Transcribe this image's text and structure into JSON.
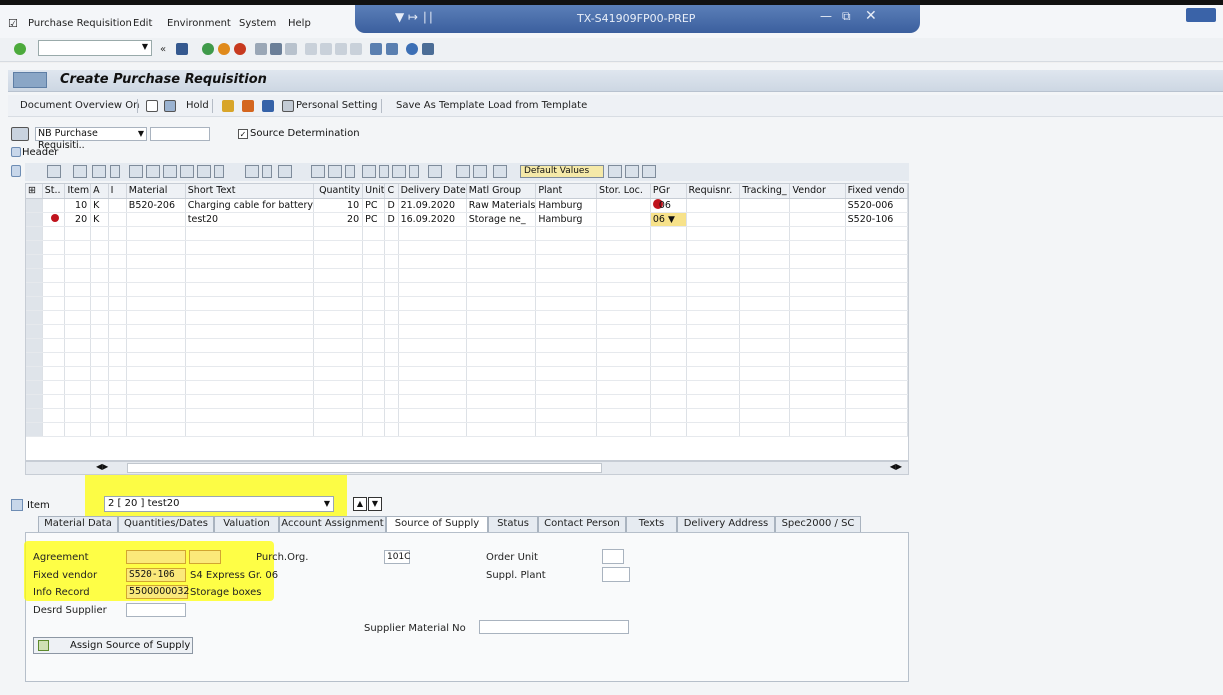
{
  "menu": {
    "items": [
      "Purchase Requisition",
      "Edit",
      "Environment",
      "System",
      "Help"
    ]
  },
  "window": {
    "title": "TX-S41909FP00-PREP"
  },
  "page": {
    "title": "Create Purchase Requisition"
  },
  "app_toolbar": {
    "document_overview": "Document Overview On",
    "hold": "Hold",
    "personal_setting": "Personal Setting",
    "save_as_template": "Save As Template",
    "load_from_template": "Load from Template"
  },
  "doc_type": {
    "value": "NB Purchase Requisiti..",
    "source_determination": "Source Determination",
    "source_determination_checked": true
  },
  "header": {
    "label": "Header"
  },
  "grid_toolbar": {
    "default_values": "Default Values"
  },
  "grid": {
    "columns": [
      "St..",
      "Item",
      "A",
      "I",
      "Material",
      "Short Text",
      "Quantity",
      "Unit",
      "C",
      "Delivery Date",
      "Matl Group",
      "Plant",
      "Stor. Loc.",
      "PGr",
      "Requisnr.",
      "Tracking_",
      "Vendor",
      "Fixed vendo"
    ],
    "rows": [
      {
        "status": "",
        "item": "10",
        "a": "K",
        "i": "",
        "material": "B520-206",
        "short_text": "Charging cable for battery",
        "quantity": "10",
        "unit": "PC",
        "c": "D",
        "delivery_date": "21.09.2020",
        "matl_group": "Raw Materials",
        "plant": "Hamburg",
        "stor_loc": "",
        "pgr": "06",
        "requisnr": "",
        "tracking": "",
        "vendor": "",
        "fixed_vendor": "S520-006"
      },
      {
        "status": "error",
        "item": "20",
        "a": "K",
        "i": "",
        "material": "",
        "short_text": "test20",
        "quantity": "20",
        "unit": "PC",
        "c": "D",
        "delivery_date": "16.09.2020",
        "matl_group": "Storage ne_",
        "plant": "Hamburg",
        "stor_loc": "",
        "pgr": "06",
        "requisnr": "",
        "tracking": "",
        "vendor": "",
        "fixed_vendor": "S520-106"
      }
    ]
  },
  "item_selector": {
    "label": "Item",
    "value": "2 [ 20 ] test20"
  },
  "tabs": [
    "Material Data",
    "Quantities/Dates",
    "Valuation",
    "Account Assignment",
    "Source of Supply",
    "Status",
    "Contact Person",
    "Texts",
    "Delivery Address",
    "Spec2000 / SC"
  ],
  "active_tab": "Source of Supply",
  "source_of_supply": {
    "agreement_label": "Agreement",
    "agreement_value": "",
    "agreement_item": "",
    "fixed_vendor_label": "Fixed vendor",
    "fixed_vendor_value": "S520-106",
    "fixed_vendor_name": "S4 Express Gr. 06",
    "info_record_label": "Info Record",
    "info_record_value": "5500000032",
    "info_record_text": "Storage boxes",
    "desrd_supplier_label": "Desrd Supplier",
    "desrd_supplier_value": "",
    "purch_org_label": "Purch.Org.",
    "purch_org_value": "101C",
    "order_unit_label": "Order Unit",
    "order_unit_value": "",
    "suppl_plant_label": "Suppl. Plant",
    "suppl_plant_value": "",
    "supplier_material_label": "Supplier Material No",
    "supplier_material_value": "",
    "assign_button": "Assign Source of Supply"
  },
  "colors": {
    "highlight": "#ffff00",
    "error": "#c0131d",
    "title_bar": "#3b5f9e"
  }
}
